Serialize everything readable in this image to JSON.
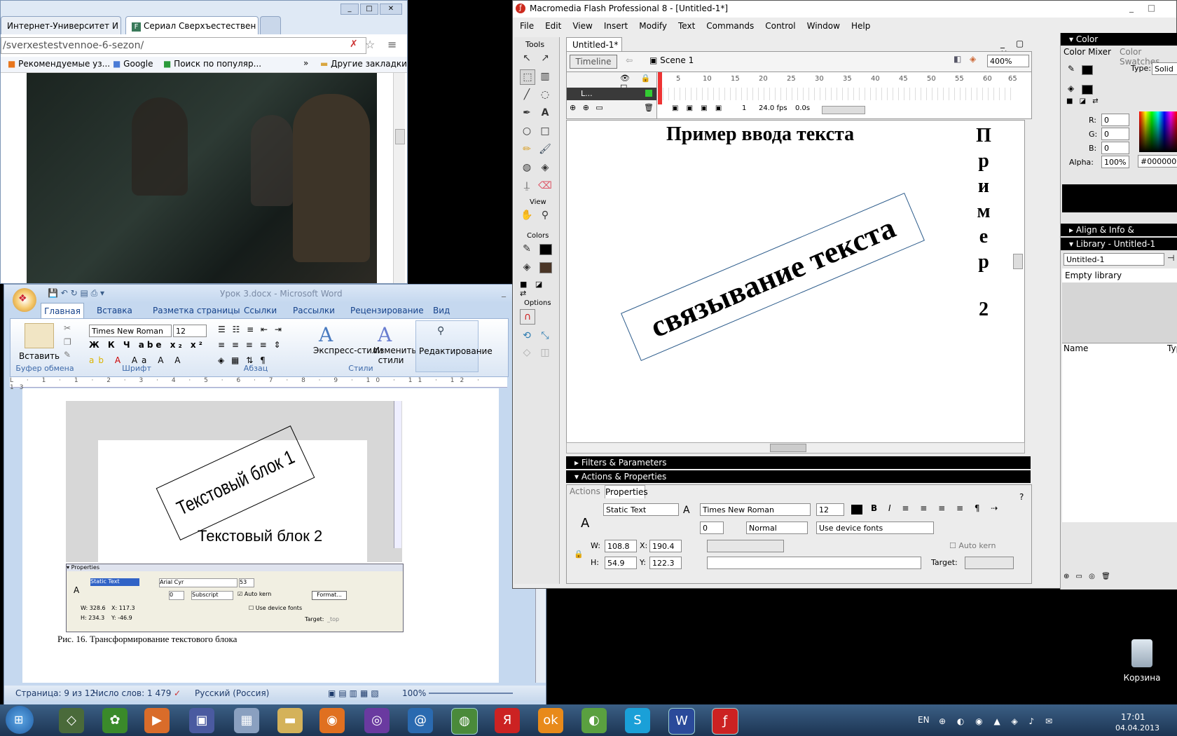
{
  "browser": {
    "tabs": [
      "Интернет-Университет И",
      "Сериал Сверхъестествен"
    ],
    "url": "/sverxestestvennoe-6-sezon/",
    "bookmarks": [
      "Рекомендуемые уз...",
      "Google",
      "Поиск по популяр...",
      "Другие закладки"
    ],
    "overflow": "»"
  },
  "word": {
    "title": "Урок 3.docx - Microsoft Word",
    "tabs": [
      "Главная",
      "Вставка",
      "Разметка страницы",
      "Ссылки",
      "Рассылки",
      "Рецензирование",
      "Вид"
    ],
    "paste": "Вставить",
    "font_name": "Times New Roman",
    "font_size": "12",
    "groups": [
      "Буфер обмена",
      "Шрифт",
      "Абзац",
      "Стили"
    ],
    "styles": [
      "Экспресс-стили",
      "Изменить стили"
    ],
    "editing": "Редактирование",
    "doc": {
      "text_block_1": "Текстовый блок 1",
      "text_block_2": "Текстовый блок 2",
      "mini_props": {
        "header": "Properties",
        "type": "Static Text",
        "font": "Arial Cyr",
        "size": "53",
        "spacing": "0",
        "position": "Subscript",
        "autokern": "Auto kern",
        "format": "Format...",
        "device": "Use device fonts",
        "W": "328.6",
        "X": "117.3",
        "H": "234.3",
        "Y": "-46.9",
        "target": "Target:",
        "target_val": "_top"
      },
      "caption": "Рис. 16. Трансформирование текстового блока"
    },
    "status": {
      "page": "Страница: 9 из 12",
      "words": "Число слов: 1 479",
      "lang": "Русский (Россия)",
      "zoom": "100%"
    }
  },
  "flash": {
    "title": "Macromedia Flash Professional 8 - [Untitled-1*]",
    "menu": [
      "File",
      "Edit",
      "View",
      "Insert",
      "Modify",
      "Text",
      "Commands",
      "Control",
      "Window",
      "Help"
    ],
    "doc_tab": "Untitled-1*",
    "tools_label": "Tools",
    "view_label": "View",
    "colors_label": "Colors",
    "options_label": "Options",
    "timeline_btn": "Timeline",
    "scene": "Scene 1",
    "zoom": "400%",
    "layer_name": "L...",
    "frame_numbers": [
      "5",
      "10",
      "15",
      "20",
      "25",
      "30",
      "35",
      "40",
      "45",
      "50",
      "55",
      "60",
      "65"
    ],
    "frame": "1",
    "fps": "24.0 fps",
    "time": "0.0s",
    "stage": {
      "heading": "Пример ввода текста",
      "rotated": "связывание текста",
      "vertical": [
        "П",
        "р",
        "и",
        "м",
        "е",
        "р",
        "",
        "2"
      ]
    },
    "filters_label": "Filters & Parameters",
    "actions_label": "Actions & Properties",
    "prop_tabs": [
      "Actions",
      "Properties"
    ],
    "props": {
      "type": "Static Text",
      "font": "Times New Roman",
      "size": "12",
      "spacing": "0",
      "position": "Normal",
      "device": "Use device fonts",
      "W": "108.8",
      "X": "190.4",
      "H": "54.9",
      "Y": "122.3",
      "autokern": "Auto kern",
      "target": "Target:"
    },
    "color_panel": {
      "title": "Color",
      "tabs": [
        "Color Mixer",
        "Color Swatches"
      ],
      "type_label": "Type:",
      "type_val": "Solid",
      "R": "0",
      "G": "0",
      "B": "0",
      "alpha": "100%",
      "hex": "#000000"
    },
    "align_label": "Align & Info & Transform",
    "library": {
      "title": "Library - Untitled-1",
      "doc": "Untitled-1",
      "status": "Empty library",
      "col_name": "Name",
      "col_type": "Typ"
    }
  },
  "desktop": {
    "recycle": "Корзина"
  },
  "taskbar": {
    "lang": "EN",
    "time": "17:01",
    "date": "04.04.2013"
  },
  "colors": {
    "accent": "#3b5f85",
    "stage_bg": "#ffffff",
    "panel_header": "#000000"
  }
}
